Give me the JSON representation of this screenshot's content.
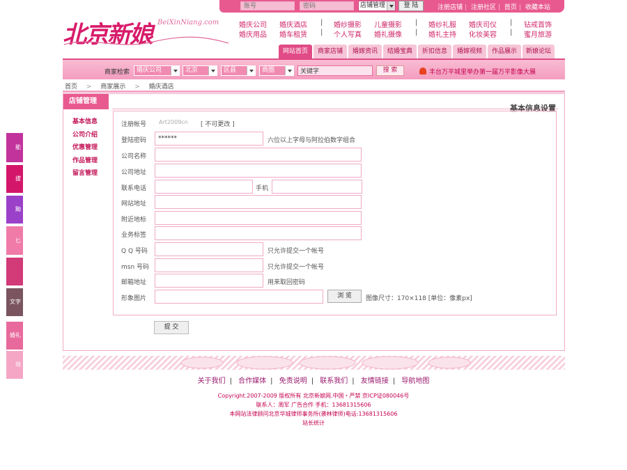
{
  "top": {
    "account_placeholder": "账号",
    "password_placeholder": "密码",
    "login_type": "店铺管理",
    "login_button": "登 陆",
    "links": [
      "注册店铺",
      "注册社区",
      "首页",
      "收藏本站"
    ]
  },
  "logo": {
    "name": "北京新娘",
    "domain": "BeiXinNiang.com"
  },
  "categories": {
    "row1": [
      "婚庆公司",
      "婚庆酒店",
      "婚纱摄影",
      "儿童摄影",
      "婚纱礼服",
      "婚庆司仪",
      "钻戒首饰"
    ],
    "row2": [
      "婚庆用品",
      "婚车租赁",
      "个人写真",
      "婚礼摄像",
      "婚礼主持",
      "化妆美容",
      "蜜月旅游"
    ],
    "separator": "|"
  },
  "nav": [
    "网站首页",
    "商家店铺",
    "婚嫁资讯",
    "结婚宝典",
    "折扣信息",
    "婚嫁视频",
    "作品展示",
    "新娘论坛"
  ],
  "search": {
    "label": "商家检索",
    "category": "婚庆公司",
    "city": "北京",
    "district": "区县",
    "area": "商圈",
    "keyword": "关键字",
    "button": "搜 索",
    "news": "丰台万平城里举办第一届万平影像大展"
  },
  "breadcrumb": [
    "首页",
    "商家展示",
    "婚庆酒店"
  ],
  "breadcrumb_sep": ">",
  "panel": {
    "tab": "店铺管理",
    "title": "基本信息设置",
    "menu": [
      "基本信息",
      "公司介绍",
      "优惠管理",
      "作品管理",
      "留言管理"
    ]
  },
  "form": {
    "account_label": "注册帐号",
    "account_value": "Art2009cn",
    "account_note": "[ 不可更改 ]",
    "password_label": "登陆密码",
    "password_value": "******",
    "password_note": "六位以上字母与阿拉伯数字组合",
    "company_label": "公司名称",
    "address_label": "公司地址",
    "phone_label": "联系电话",
    "mobile_label": "手机",
    "website_label": "网站地址",
    "landmark_label": "附近地标",
    "tags_label": "业务标签",
    "qq_label": "Q Q 号码",
    "qq_note": "只允许提交一个帐号",
    "msn_label": "msn 号码",
    "msn_note": "只允许提交一个帐号",
    "email_label": "邮箱地址",
    "email_note": "用来取回密码",
    "image_label": "形象图片",
    "browse_button": "浏 览",
    "image_note": "图像尺寸：170×118 [单位：像素px]",
    "submit_button": "提 交"
  },
  "side_tabs": [
    {
      "label": "能",
      "color": "#c2339c"
    },
    {
      "label": "拔",
      "color": "#d4166a"
    },
    {
      "label": "黝",
      "color": "#9b40c9"
    },
    {
      "label": "匕",
      "color": "#f07ba8"
    },
    {
      "label": "",
      "color": "#d23a78"
    },
    {
      "label": "文字",
      "color": "#7a5560"
    },
    {
      "label": "婚礼",
      "color": "#e86a9c"
    },
    {
      "label": "效",
      "color": "#f4a6c4"
    }
  ],
  "footer": {
    "links": [
      "关于我们",
      "合作媒体",
      "免责说明",
      "联系我们",
      "友情链接",
      "导航地图"
    ],
    "copyright": "Copyright.2007-2009 版权所有 北京新娘网.中国・严禁 京ICP证080046号",
    "contact": "联系人：周军    广告合作  手机：13681315606",
    "lawyer": "本网站法律顾问北京华城律师事务所(袭林律师)电话:13681315606",
    "stats": "站长统计"
  },
  "colors": {
    "brand": "#e85a8f",
    "accent": "#d81b6a",
    "border": "#f0aac6"
  }
}
